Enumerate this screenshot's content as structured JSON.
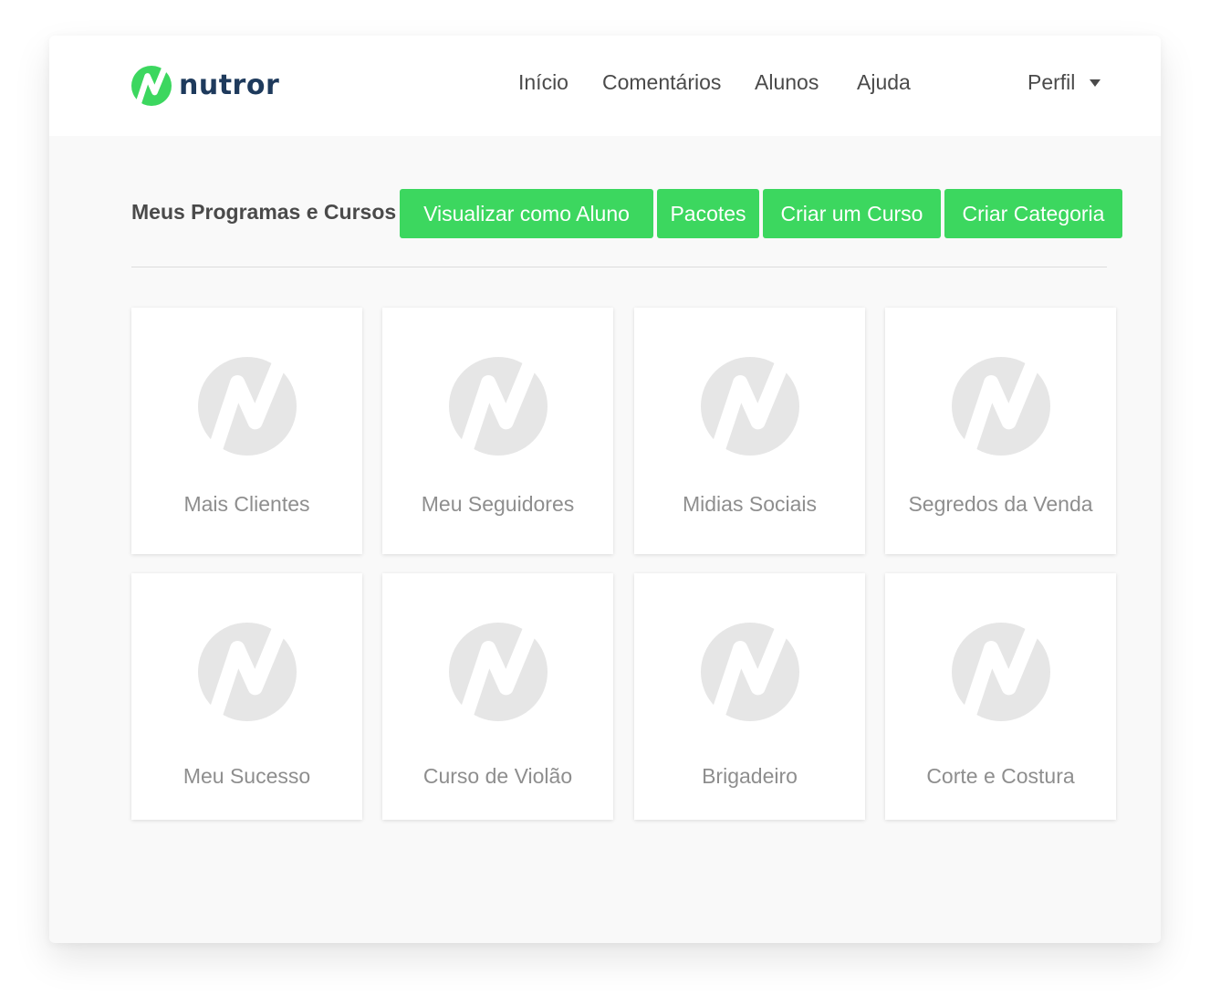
{
  "brand": {
    "name": "nutror",
    "accent": "#3cd75f",
    "text_color": "#1e3a5c"
  },
  "nav": {
    "items": [
      {
        "label": "Início"
      },
      {
        "label": "Comentários"
      },
      {
        "label": "Alunos"
      },
      {
        "label": "Ajuda"
      }
    ],
    "profile": {
      "label": "Perfil",
      "icon": "caret-down-icon"
    }
  },
  "section": {
    "title": "Meus Programas e Cursos",
    "buttons": [
      {
        "label": "Visualizar como Aluno"
      },
      {
        "label": "Pacotes"
      },
      {
        "label": "Criar um Curso"
      },
      {
        "label": "Criar Categoria"
      }
    ]
  },
  "courses": [
    {
      "title": "Mais Clientes",
      "icon": "nutror-placeholder-icon"
    },
    {
      "title": "Meu Seguidores",
      "icon": "nutror-placeholder-icon"
    },
    {
      "title": "Midias Sociais",
      "icon": "nutror-placeholder-icon"
    },
    {
      "title": "Segredos da Venda",
      "icon": "nutror-placeholder-icon"
    },
    {
      "title": "Meu Sucesso",
      "icon": "nutror-placeholder-icon"
    },
    {
      "title": "Curso de Violão",
      "icon": "nutror-placeholder-icon"
    },
    {
      "title": "Brigadeiro",
      "icon": "nutror-placeholder-icon"
    },
    {
      "title": "Corte e Costura",
      "icon": "nutror-placeholder-icon"
    }
  ]
}
